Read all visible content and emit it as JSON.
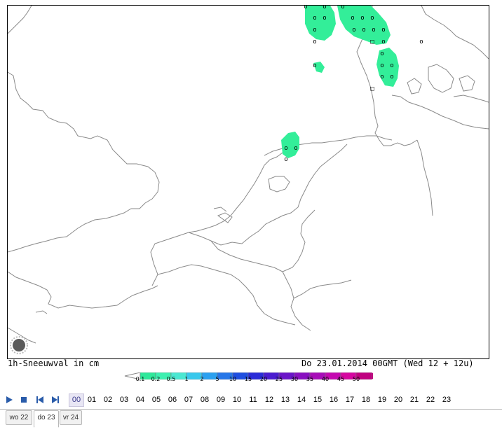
{
  "map": {
    "caption_left": "1h-Sneeuwval in cm",
    "caption_right": "Do 23.01.2014 00GMT (Wed 12 + 12u)",
    "snow_color": "#33ee99",
    "coast_color": "#888888",
    "marker_symbol": "o",
    "marker_alt_symbol": "□"
  },
  "legend": {
    "labels": [
      "0.1",
      "0.2",
      "0.5",
      "1",
      "2",
      "5",
      "10",
      "15",
      "20",
      "25",
      "30",
      "35",
      "40",
      "45",
      "50"
    ],
    "colors": [
      "#2ee89a",
      "#3df0b0",
      "#4ae8d2",
      "#38c8ec",
      "#2aa0f0",
      "#2676e8",
      "#1e4ee0",
      "#2a2cd8",
      "#4a1cd0",
      "#6a14c8",
      "#8810c0",
      "#a80cb8",
      "#c408b0",
      "#d606a0",
      "#c00080"
    ]
  },
  "timeline": {
    "hours": [
      "00",
      "01",
      "02",
      "03",
      "04",
      "05",
      "06",
      "07",
      "08",
      "09",
      "10",
      "11",
      "12",
      "13",
      "14",
      "15",
      "16",
      "17",
      "18",
      "19",
      "20",
      "21",
      "22",
      "23"
    ],
    "active_hour": "00",
    "buttons": [
      "play-icon",
      "stop-icon",
      "skip-back-icon",
      "skip-forward-icon"
    ]
  },
  "days": [
    {
      "label": "wo 22",
      "active": false
    },
    {
      "label": "do 23",
      "active": true
    },
    {
      "label": "vr 24",
      "active": false
    }
  ]
}
